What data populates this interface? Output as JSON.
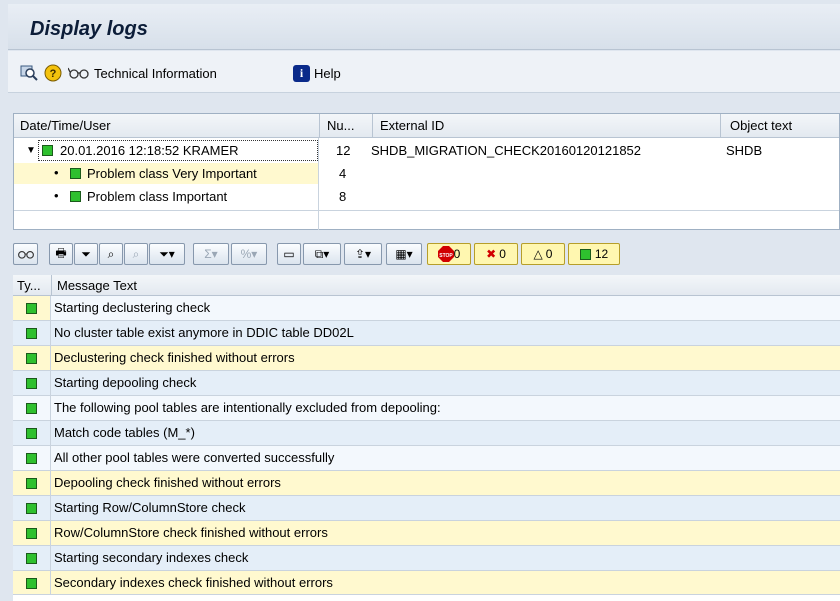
{
  "window": {
    "title": "Display logs"
  },
  "toolbar": {
    "technical_info_label": "Technical Information",
    "help_label": "Help"
  },
  "tree": {
    "headers": [
      "Date/Time/User",
      "Nu...",
      "External ID",
      "Object text"
    ],
    "log": {
      "datetime_user": "20.01.2016 12:18:52 KRAMER",
      "number": "12",
      "external_id": "SHDB_MIGRATION_CHECK20160120121852",
      "object_text": "SHDB"
    },
    "children": [
      {
        "label": "Problem class Very Important",
        "number": "4"
      },
      {
        "label": "Problem class Important",
        "number": "8"
      }
    ]
  },
  "alv_toolbar": {
    "count_stop": "0",
    "count_error": "0",
    "count_warning": "0",
    "count_success": "12"
  },
  "messages": {
    "headers": {
      "type": "Ty...",
      "text": "Message Text"
    },
    "rows": [
      "Starting declustering check",
      "No cluster table exist anymore in DDIC table DD02L",
      "Declustering check finished without errors",
      "Starting depooling check",
      "The following pool tables are intentionally excluded from depooling:",
      "Match code tables (M_*)",
      "All other pool tables were converted successfully",
      "Depooling check finished without errors",
      "Starting Row/ColumnStore check",
      "Row/ColumnStore check finished without errors",
      "Starting secondary indexes check",
      "Secondary indexes check finished without errors"
    ]
  },
  "colors": {
    "success": "#2ec02e",
    "row_highlight": "#fff9cf",
    "row_alt": "#e4eef8"
  }
}
